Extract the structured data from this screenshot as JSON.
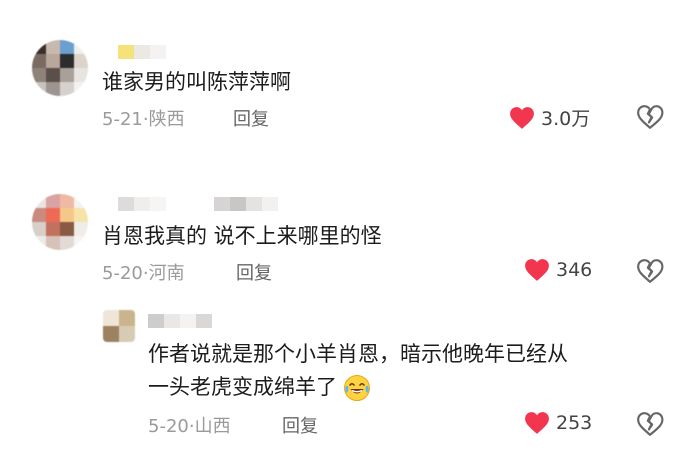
{
  "comments": [
    {
      "text": "谁家男的叫陈萍萍啊",
      "date": "5-21",
      "region": "陕西",
      "reply_label": "回复",
      "likes": "3.0万"
    },
    {
      "text": "肖恩我真的 说不上来哪里的怪",
      "date": "5-20",
      "region": "河南",
      "reply_label": "回复",
      "likes": "346"
    }
  ],
  "reply": {
    "text_line1": "作者说就是那个小羊肖恩，暗示他晚年已经从",
    "text_line2": "一头老虎变成绵羊了",
    "emoji": "laughing-tears-emoji",
    "date": "5-20",
    "region": "山西",
    "reply_label": "回复",
    "likes": "253"
  },
  "icons": {
    "like": "heart-icon",
    "dislike": "broken-heart-icon"
  },
  "colors": {
    "heart": "#f2364f",
    "meta": "#9a9a9a"
  },
  "separator": "·"
}
